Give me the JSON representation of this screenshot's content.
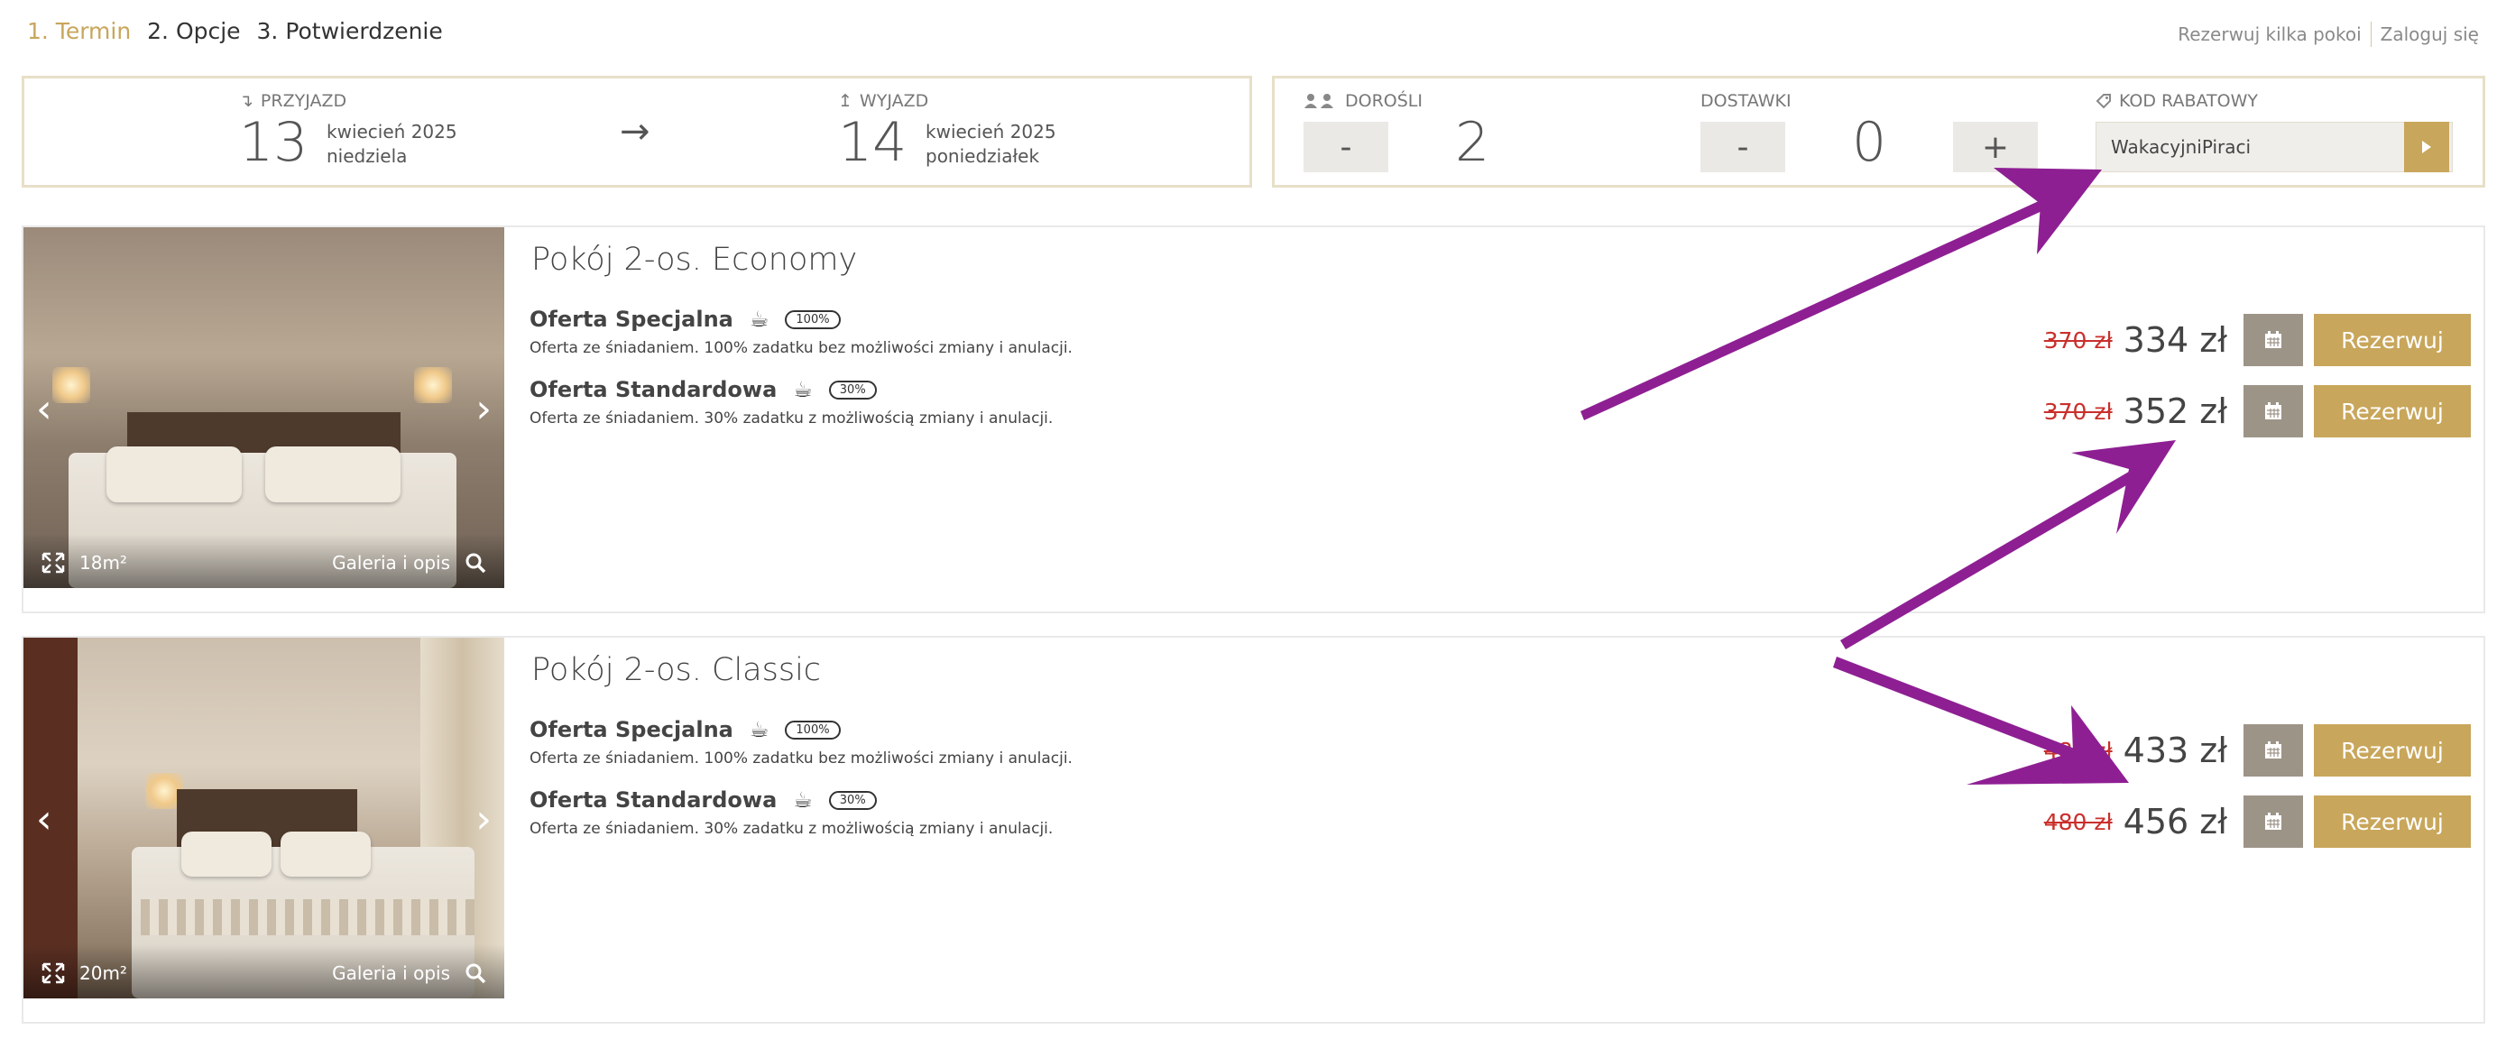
{
  "steps": [
    {
      "label": "1. Termin",
      "active": true
    },
    {
      "label": "2. Opcje",
      "active": false
    },
    {
      "label": "3. Potwierdzenie",
      "active": false
    }
  ],
  "top_links": {
    "book_multiple": "Rezerwuj kilka pokoi",
    "login": "Zaloguj się"
  },
  "arrival": {
    "label": "PRZYJAZD",
    "day": "13",
    "month": "kwiecień 2025",
    "weekday": "niedziela"
  },
  "departure": {
    "label": "WYJAZD",
    "day": "14",
    "month": "kwiecień 2025",
    "weekday": "poniedziałek"
  },
  "adults": {
    "label": "DOROŚLI",
    "minus": "-",
    "value": "2"
  },
  "extra_beds": {
    "label": "DOSTAWKI",
    "minus": "-",
    "value": "0",
    "plus": "+"
  },
  "promo": {
    "label": "KOD RABATOWY",
    "value": "WakacyjniPiraci"
  },
  "rooms": [
    {
      "title": "Pokój 2-os. Economy",
      "area": "18m²",
      "gallery": "Galeria i opis",
      "offers": [
        {
          "name": "Oferta Specjalna",
          "deposit": "100%",
          "desc": "Oferta ze śniadaniem. 100% zadatku bez możliwości zmiany i anulacji.",
          "old_price": "370 zł",
          "price": "334 zł",
          "book": "Rezerwuj"
        },
        {
          "name": "Oferta Standardowa",
          "deposit": "30%",
          "desc": "Oferta ze śniadaniem. 30% zadatku z możliwością zmiany i anulacji.",
          "old_price": "370 zł",
          "price": "352 zł",
          "book": "Rezerwuj"
        }
      ]
    },
    {
      "title": "Pokój 2-os. Classic",
      "area": "20m²",
      "gallery": "Galeria i opis",
      "offers": [
        {
          "name": "Oferta Specjalna",
          "deposit": "100%",
          "desc": "Oferta ze śniadaniem. 100% zadatku bez możliwości zmiany i anulacji.",
          "old_price": "480 zł",
          "price": "433 zł",
          "book": "Rezerwuj"
        },
        {
          "name": "Oferta Standardowa",
          "deposit": "30%",
          "desc": "Oferta ze śniadaniem. 30% zadatku z możliwością zmiany i anulacji.",
          "old_price": "480 zł",
          "price": "456 zł",
          "book": "Rezerwuj"
        }
      ]
    }
  ],
  "colors": {
    "accent": "#c8a65b",
    "old_price": "#c9302c",
    "annotation_arrow": "#8e1f93",
    "calendar_button": "#9d9488"
  },
  "icons": {
    "prev": "chevron-left-icon",
    "next": "chevron-right-icon",
    "expand": "expand-icon",
    "search": "search-icon",
    "calendar": "calendar-icon",
    "coffee": "coffee-cup-icon",
    "tag": "tag-icon",
    "users": "users-icon"
  }
}
